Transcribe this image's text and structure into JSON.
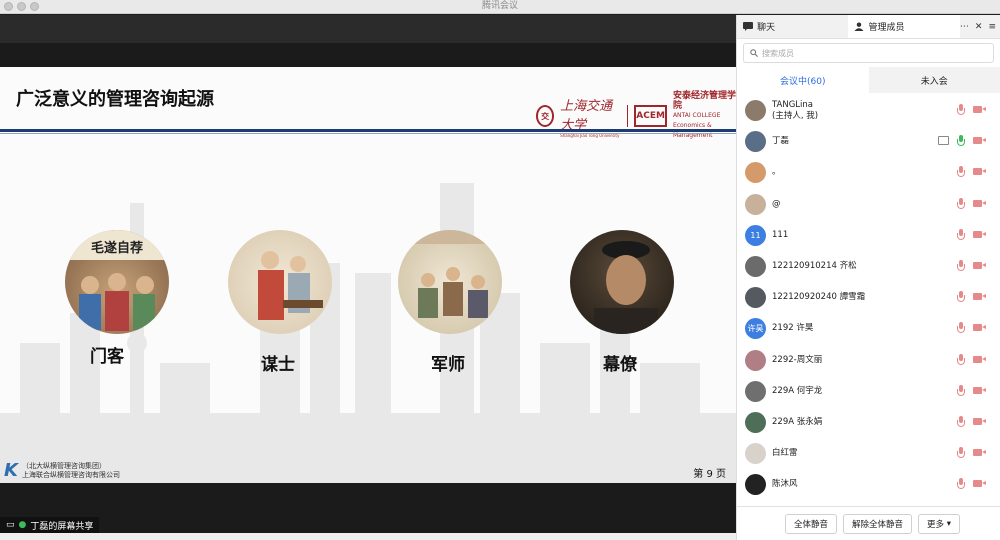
{
  "window": {
    "title": "腾讯会议"
  },
  "slide": {
    "title": "广泛意义的管理咨询起源",
    "logo_sjtu": "上海交通大学",
    "logo_sjtu_sub": "Shanghai Jiao Tong University",
    "logo_antai_cn": "安泰经济管理学院",
    "logo_antai_en": "ANTAI COLLEGE",
    "logo_antai_en2": "Economics & Management",
    "items": [
      {
        "label": "门客",
        "caption": "毛遂自荐"
      },
      {
        "label": "谋士"
      },
      {
        "label": "军师"
      },
      {
        "label": "幕僚"
      }
    ],
    "footer_line1": "（北大纵横管理咨询集团）",
    "footer_line2": "上海联合纵横管理咨询有限公司",
    "page": "第 9 页"
  },
  "share_badge": {
    "text": "丁磊的屏幕共享"
  },
  "panel": {
    "tab_chat": "聊天",
    "tab_members": "管理成员",
    "search_placeholder": "搜索成员",
    "seg_in": "会议中(60)",
    "seg_out": "未入会",
    "members": [
      {
        "name": "TANGLina",
        "sub": "(主持人, 我)",
        "avatar": "#8c7a6b",
        "initials": "",
        "mic": "muted"
      },
      {
        "name": "丁磊",
        "sub": "",
        "avatar": "#5a6e88",
        "initials": "",
        "mic": "on",
        "screen": true
      },
      {
        "name": "。",
        "sub": "",
        "avatar": "#d49a6a",
        "initials": "",
        "mic": "muted"
      },
      {
        "name": "@",
        "sub": "",
        "avatar": "#c8b19a",
        "initials": "",
        "mic": "muted"
      },
      {
        "name": "111",
        "sub": "",
        "avatar": "#3d7fe0",
        "initials": "11",
        "mic": "muted"
      },
      {
        "name": "122120910214 齐松",
        "sub": "",
        "avatar": "#6b6b6b",
        "initials": "",
        "mic": "muted"
      },
      {
        "name": "122120920240 譚雪霜",
        "sub": "",
        "avatar": "#555a60",
        "initials": "",
        "mic": "muted"
      },
      {
        "name": "2192 许昊",
        "sub": "",
        "avatar": "#3d7fe0",
        "initials": "许昊",
        "mic": "muted"
      },
      {
        "name": "2292-周文丽",
        "sub": "",
        "avatar": "#b07f86",
        "initials": "",
        "mic": "muted"
      },
      {
        "name": "229A 何宇龙",
        "sub": "",
        "avatar": "#6f6f6f",
        "initials": "",
        "mic": "muted"
      },
      {
        "name": "229A 张永娟",
        "sub": "",
        "avatar": "#4e6e57",
        "initials": "",
        "mic": "muted"
      },
      {
        "name": "白红雷",
        "sub": "",
        "avatar": "#d8d2cb",
        "initials": "",
        "mic": "muted"
      },
      {
        "name": "陈沐风",
        "sub": "",
        "avatar": "#222222",
        "initials": "",
        "mic": "muted"
      }
    ],
    "btn_mute_all": "全体静音",
    "btn_unmute_all": "解除全体静音",
    "btn_more": "更多"
  }
}
